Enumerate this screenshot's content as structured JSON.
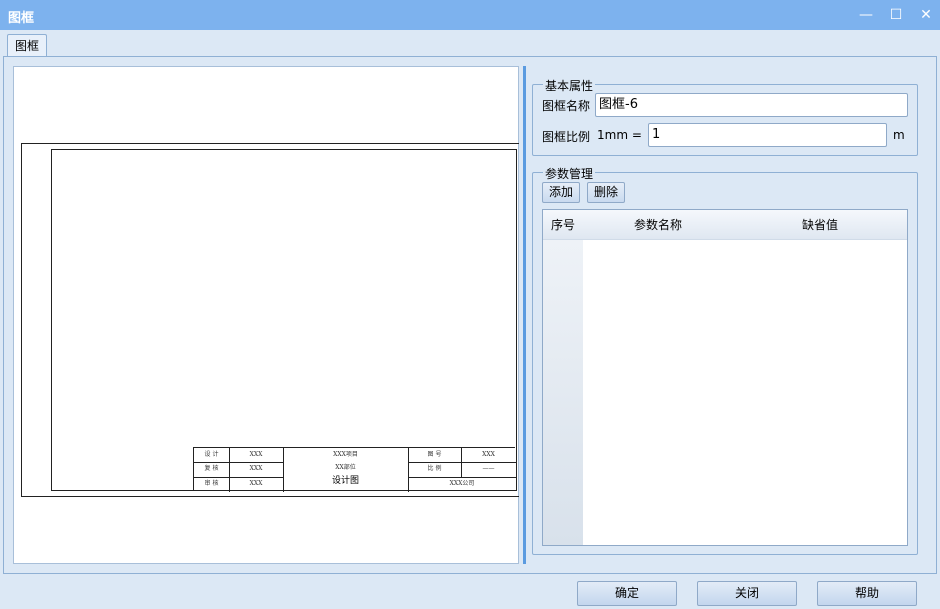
{
  "window": {
    "title": "图框",
    "minimize": "—",
    "maximize": "☐",
    "close": "✕"
  },
  "tabs": [
    {
      "label": "图框"
    }
  ],
  "preview": {
    "title_block": {
      "c1": [
        "设 计",
        "复 核",
        "审 核"
      ],
      "c2": [
        "XXX",
        "XXX",
        "XXX"
      ],
      "c3": [
        "XXX项目",
        "XX部位",
        "设计图"
      ],
      "c4": [
        "图 号",
        "比 例"
      ],
      "c5": [
        "XXX",
        "——"
      ],
      "company": "XXX公司"
    }
  },
  "basic": {
    "legend": "基本属性",
    "name_label": "图框名称",
    "name_value": "图框-6",
    "scale_label": "图框比例",
    "scale_prefix": "1mm =",
    "scale_value": "1",
    "scale_unit": "m"
  },
  "params": {
    "legend": "参数管理",
    "add_label": "添加",
    "delete_label": "删除",
    "columns": [
      "序号",
      "参数名称",
      "缺省值"
    ]
  },
  "footer": {
    "ok_label": "确定",
    "close_label": "关闭",
    "help_label": "帮助"
  }
}
